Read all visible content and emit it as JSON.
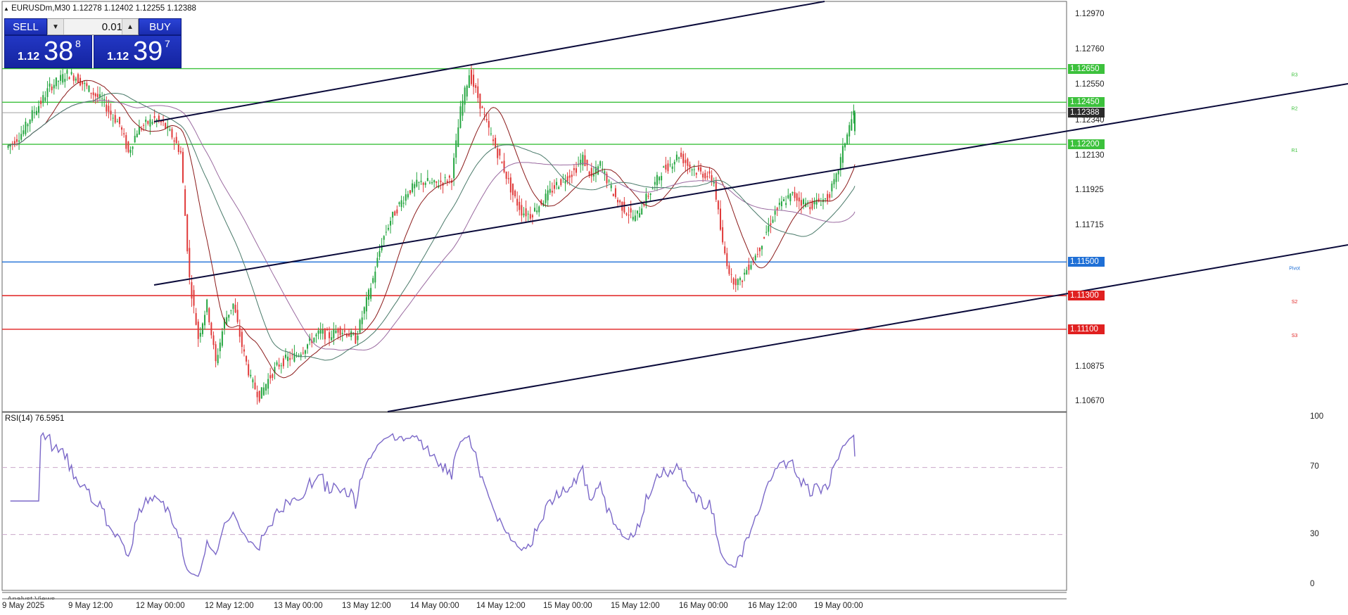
{
  "window": {
    "symbol_line": "EURUSDm,M30  1.12278 1.12402 1.12255 1.12388"
  },
  "trade_panel": {
    "sell_label": "SELL",
    "buy_label": "BUY",
    "lot_value": "0.01",
    "sell_price_small": "1.12",
    "sell_price_big": "38",
    "sell_price_sup": "8",
    "buy_price_small": "1.12",
    "buy_price_big": "39",
    "buy_price_sup": "7"
  },
  "price_axis": {
    "ticks": [
      "1.12970",
      "1.12760",
      "1.12550",
      "1.12340",
      "1.12130",
      "1.11925",
      "1.11715",
      "1.10875",
      "1.10670"
    ],
    "current_price": "1.12388"
  },
  "levels": [
    {
      "id": "r3",
      "price": "1.12650",
      "label": "R3",
      "color": "#3cc13c"
    },
    {
      "id": "r2",
      "price": "1.12450",
      "label": "R2",
      "color": "#3cc13c"
    },
    {
      "id": "r1",
      "price": "1.12200",
      "label": "R1",
      "color": "#3cc13c"
    },
    {
      "id": "pivot",
      "price": "1.11500",
      "label": "Pivot",
      "color": "#1e6fd6"
    },
    {
      "id": "s2",
      "price": "1.11300",
      "label": "S2",
      "color": "#e02020"
    },
    {
      "id": "s3",
      "price": "1.11100",
      "label": "S3",
      "color": "#e02020"
    }
  ],
  "rsi": {
    "title": "RSI(14) 76.5951",
    "ticks": [
      "100",
      "70",
      "30",
      "0"
    ],
    "period": 14,
    "value": 76.5951
  },
  "analyst_views_label": "Analyst Views",
  "time_axis": {
    "labels": [
      "9 May 2025",
      "9 May 12:00",
      "12 May 00:00",
      "12 May 12:00",
      "13 May 00:00",
      "13 May 12:00",
      "14 May 00:00",
      "14 May 12:00",
      "15 May 00:00",
      "15 May 12:00",
      "16 May 00:00",
      "16 May 12:00",
      "19 May 00:00"
    ]
  },
  "colors": {
    "bull_candle": "#26a641",
    "bear_candle": "#e03a3a",
    "rsi_line": "#7b68c8",
    "ma_fast": "#8b1a1a",
    "ma_mid": "#9a6aa0",
    "ma_slow": "#4a7a6a",
    "trendline": "#0a0a3a"
  },
  "chart_data": {
    "type": "candlestick",
    "symbol": "EURUSDm",
    "timeframe": "M30",
    "last_bar": {
      "open": 1.12278,
      "high": 1.12402,
      "low": 1.12255,
      "close": 1.12388
    },
    "y_range": [
      1.1061,
      1.1305
    ],
    "close_path": [
      1.1218,
      1.1222,
      1.1228,
      1.1238,
      1.1245,
      1.1254,
      1.1258,
      1.1262,
      1.126,
      1.1255,
      1.125,
      1.1246,
      1.1238,
      1.1232,
      1.1215,
      1.1228,
      1.1232,
      1.1235,
      1.1232,
      1.1225,
      1.1215,
      1.114,
      1.1105,
      1.1125,
      1.109,
      1.1115,
      1.1125,
      1.11,
      1.108,
      1.107,
      1.108,
      1.1088,
      1.1092,
      1.1094,
      1.1098,
      1.1104,
      1.1108,
      1.1106,
      1.111,
      1.1108,
      1.1104,
      1.1122,
      1.114,
      1.1162,
      1.1175,
      1.1184,
      1.1192,
      1.1196,
      1.1198,
      1.1196,
      1.1198,
      1.12,
      1.124,
      1.1262,
      1.1248,
      1.1232,
      1.1218,
      1.1205,
      1.119,
      1.118,
      1.1178,
      1.1184,
      1.119,
      1.1196,
      1.12,
      1.1204,
      1.1212,
      1.12,
      1.1208,
      1.1196,
      1.1186,
      1.118,
      1.1176,
      1.1186,
      1.1194,
      1.1204,
      1.1208,
      1.1214,
      1.1208,
      1.1204,
      1.1202,
      1.1198,
      1.116,
      1.114,
      1.1138,
      1.1148,
      1.1156,
      1.1168,
      1.118,
      1.1186,
      1.119,
      1.1186,
      1.1184,
      1.1186,
      1.1188,
      1.12,
      1.1222,
      1.1239
    ],
    "trendlines": [
      {
        "from": {
          "time": "12 May 00:00",
          "price": 1.1234
        },
        "to": {
          "time": "19 May",
          "price": 1.1255
        },
        "note": "channel upper segment"
      },
      {
        "from": {
          "time": "12 May 00:00",
          "price": 1.1142
        },
        "to": {
          "time": "19 May",
          "price": 1.1255
        },
        "note": "channel mid line"
      },
      {
        "from": {
          "time": "13 May",
          "price": 1.1062
        },
        "to": {
          "time": "19 May",
          "price": 1.1158
        },
        "note": "channel lower line"
      }
    ],
    "rsi_levels": [
      70,
      30
    ]
  }
}
